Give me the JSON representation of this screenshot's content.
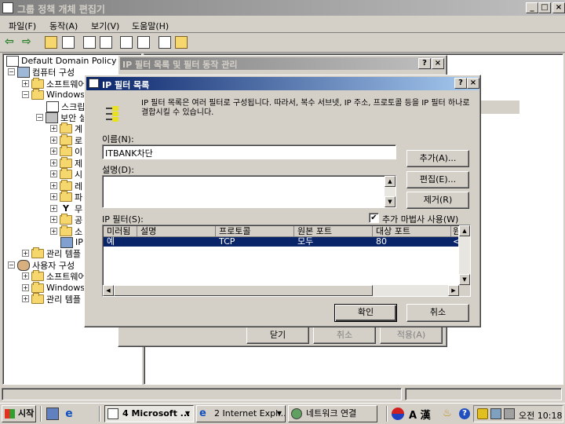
{
  "main_window": {
    "title": "그룹 정책 개체 편집기",
    "menu": [
      "파일(F)",
      "동작(A)",
      "보기(V)",
      "도움말(H)"
    ]
  },
  "tree": {
    "root": "Default Domain Policy [I",
    "computer_config": "컴퓨터 구성",
    "software1": "소프트웨어",
    "windows1": "Windows",
    "scripts": "스크립",
    "security": "보안 설",
    "sub": [
      "계",
      "로",
      "이",
      "제",
      "시",
      "레",
      "파",
      "무",
      "공",
      "소",
      "IP"
    ],
    "admin1": "관리 템플",
    "user_config": "사용자 구성",
    "software2": "소프트웨어",
    "windows2": "Windows",
    "admin2": "관리 템플"
  },
  "bg_dialog": {
    "title": "IP 필터 목록 및 필터 동작 관리",
    "close_label": "닫기",
    "cancel_label": "취소",
    "apply_label": "적용(A)"
  },
  "dialog": {
    "title": "IP 필터 목록",
    "description": "IP 필터 목록은 여러 필터로 구성됩니다. 따라서, 복수 서브넷, IP 주소, 프로토콜 등을 IP 필터 하나로 결합시킬 수 있습니다.",
    "name_label": "이름(N):",
    "name_value": "ITBANK차단",
    "desc_label": "설명(D):",
    "desc_value": "",
    "add_label": "추가(A)...",
    "edit_label": "편집(E)...",
    "remove_label": "제거(R)",
    "filters_label": "IP 필터(S):",
    "wizard_label": "추가 마법사 사용(W)",
    "wizard_checked": true,
    "columns": [
      "미러됨",
      "설명",
      "프로토콜",
      "원본 포트",
      "대상 포트",
      "원본"
    ],
    "rows": [
      {
        "mirrored": "예",
        "desc": "",
        "protocol": "TCP",
        "src_port": "모두",
        "dst_port": "80",
        "src": "<내"
      }
    ],
    "ok_label": "확인",
    "cancel_label": "취소"
  },
  "taskbar": {
    "start_label": "시작",
    "tasks": [
      "4 Microsoft ...",
      "2 Internet Expl...",
      "네트워크 연결"
    ],
    "ime": "A 漢",
    "time": "오전 10:18"
  }
}
